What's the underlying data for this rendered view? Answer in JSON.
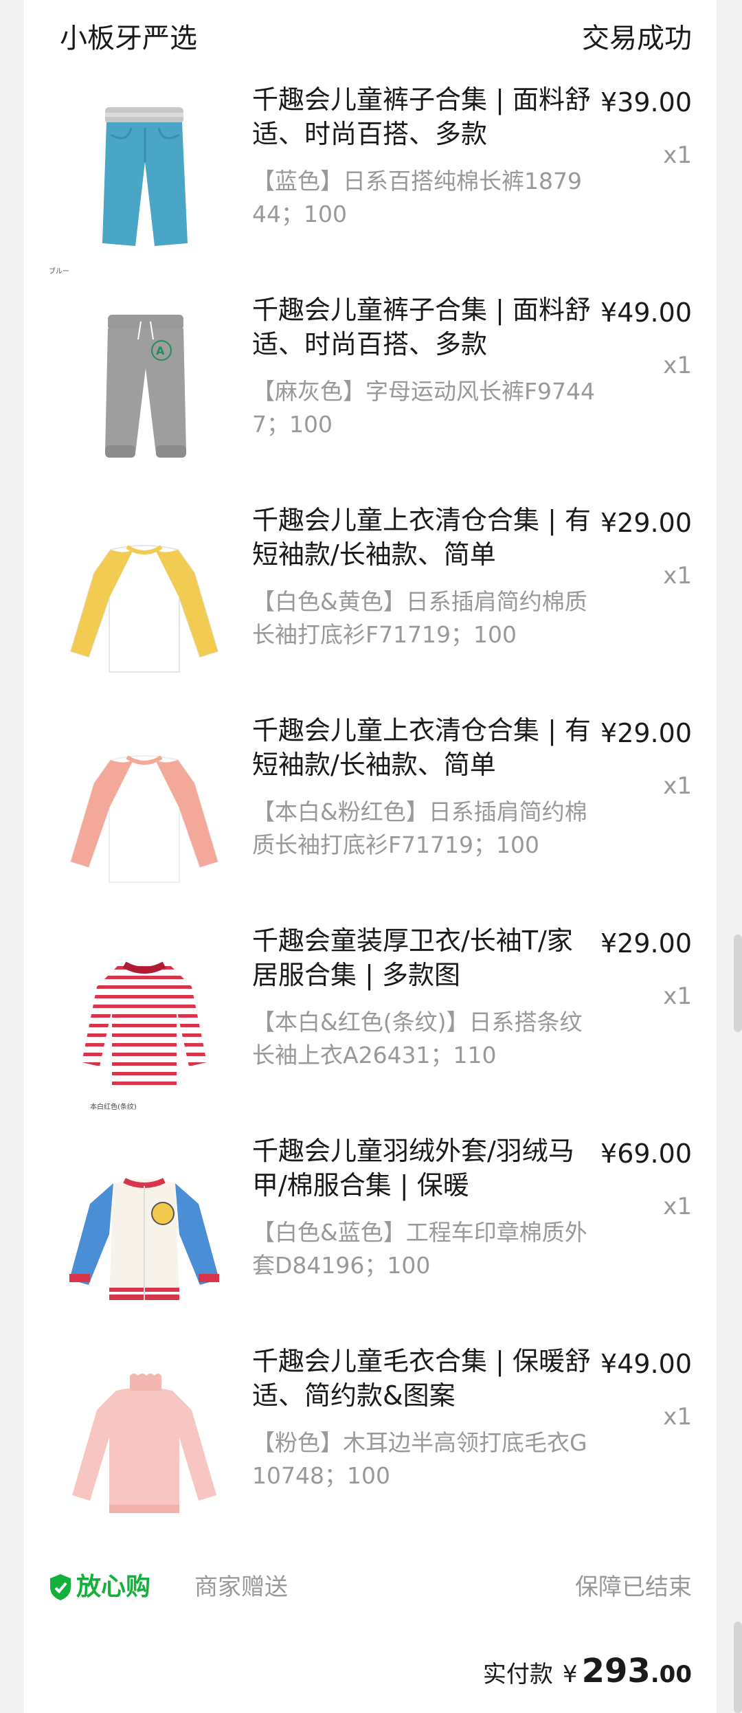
{
  "shop": {
    "name": "小板牙严选",
    "status": "交易成功"
  },
  "items": [
    {
      "title": "千趣会儿童裤子合集 | 面料舒适、时尚百搭、多款",
      "sku": "【蓝色】日系百搭纯棉长裤187944；100",
      "price": "¥39.00",
      "qty": "x1",
      "thumb_icon": "blue-pants-icon",
      "thumb_caption": "ブルー"
    },
    {
      "title": "千趣会儿童裤子合集 | 面料舒适、时尚百搭、多款",
      "sku": "【麻灰色】字母运动风长裤F97447；100",
      "price": "¥49.00",
      "qty": "x1",
      "thumb_icon": "gray-sweatpants-icon"
    },
    {
      "title": "千趣会儿童上衣清仓合集 | 有短袖款/长袖款、简单",
      "sku": "【白色&黄色】日系插肩简约棉质长袖打底衫F71719；100",
      "price": "¥29.00",
      "qty": "x1",
      "thumb_icon": "yellow-raglan-shirt-icon"
    },
    {
      "title": "千趣会儿童上衣清仓合集 | 有短袖款/长袖款、简单",
      "sku": "【本白&粉红色】日系插肩简约棉质长袖打底衫F71719；100",
      "price": "¥29.00",
      "qty": "x1",
      "thumb_icon": "pink-raglan-shirt-icon"
    },
    {
      "title": "千趣会童装厚卫衣/长袖T/家居服合集 | 多款图",
      "sku": "【本白&红色(条纹)】日系搭条纹长袖上衣A26431；110",
      "price": "¥29.00",
      "qty": "x1",
      "thumb_icon": "red-striped-top-icon",
      "thumb_caption": "本白红色(条纹)"
    },
    {
      "title": "千趣会儿童羽绒外套/羽绒马甲/棉服合集 | 保暖",
      "sku": "【白色&蓝色】工程车印章棉质外套D84196；100",
      "price": "¥69.00",
      "qty": "x1",
      "thumb_icon": "varsity-jacket-icon"
    },
    {
      "title": "千趣会儿童毛衣合集 | 保暖舒适、简约款&图案",
      "sku": "【粉色】木耳边半高领打底毛衣G10748；100",
      "price": "¥49.00",
      "qty": "x1",
      "thumb_icon": "pink-sweater-icon"
    }
  ],
  "footer": {
    "guarantee_label": "放心购",
    "gift_label": "商家赠送",
    "guarantee_status": "保障已结束",
    "guarantee_icon": "shield-check-icon",
    "guarantee_color": "#14b03c"
  },
  "total": {
    "label": "实付款",
    "currency": "¥",
    "integer": "293",
    "decimal": ".00"
  }
}
